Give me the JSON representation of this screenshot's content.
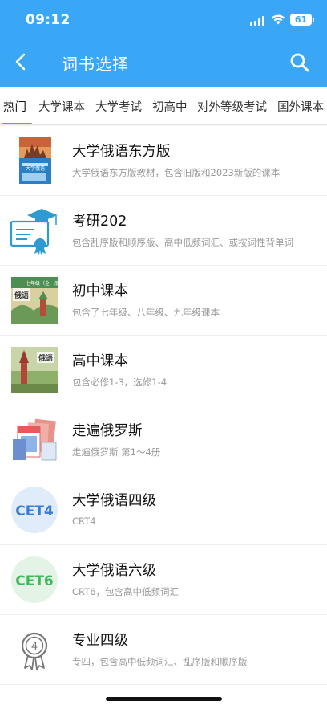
{
  "status_bar": {
    "time": "09:12",
    "battery": "61"
  },
  "header": {
    "title": "词书选择"
  },
  "tabs": [
    {
      "label": "热门",
      "active": true
    },
    {
      "label": "大学课本"
    },
    {
      "label": "大学考试"
    },
    {
      "label": "初高中"
    },
    {
      "label": "对外等级考试"
    },
    {
      "label": "国外课本"
    }
  ],
  "items": [
    {
      "title": "大学俄语东方版",
      "desc": "大学俄语东方版教材，包含旧版和2023新版的课本",
      "icon": "book-cover-icon"
    },
    {
      "title": "考研202",
      "desc": "包含乱序版和顺序版、高中低频词汇、或按词性背单词",
      "icon": "graduation-cert-icon"
    },
    {
      "title": "初中课本",
      "desc": "包含了七年级、八年级、九年级课本",
      "icon": "middle-school-book-icon"
    },
    {
      "title": "高中课本",
      "desc": "包含必修1-3，选修1-4",
      "icon": "high-school-book-icon"
    },
    {
      "title": "走遍俄罗斯",
      "desc": "走遍俄罗斯 第1～4册",
      "icon": "book-stack-icon"
    },
    {
      "title": "大学俄语四级",
      "desc": "CRT4",
      "icon": "cet4-badge-icon",
      "badge": "CET4"
    },
    {
      "title": "大学俄语六级",
      "desc": "CRT6，包含高中低频词汇",
      "icon": "cet6-badge-icon",
      "badge": "CET6"
    },
    {
      "title": "专业四级",
      "desc": "专四，包含高中低频词汇、乱序版和顺序版",
      "icon": "medal-4-icon",
      "badge": "4"
    }
  ],
  "cover_text": {
    "b1": "大学俄语",
    "b3": "俄语",
    "b3_label": "七年级（全一册）",
    "b4": "俄语"
  },
  "colors": {
    "accent": "#3aa6f6",
    "cet4": "#3a7bd5",
    "cet6": "#3fb95b"
  }
}
